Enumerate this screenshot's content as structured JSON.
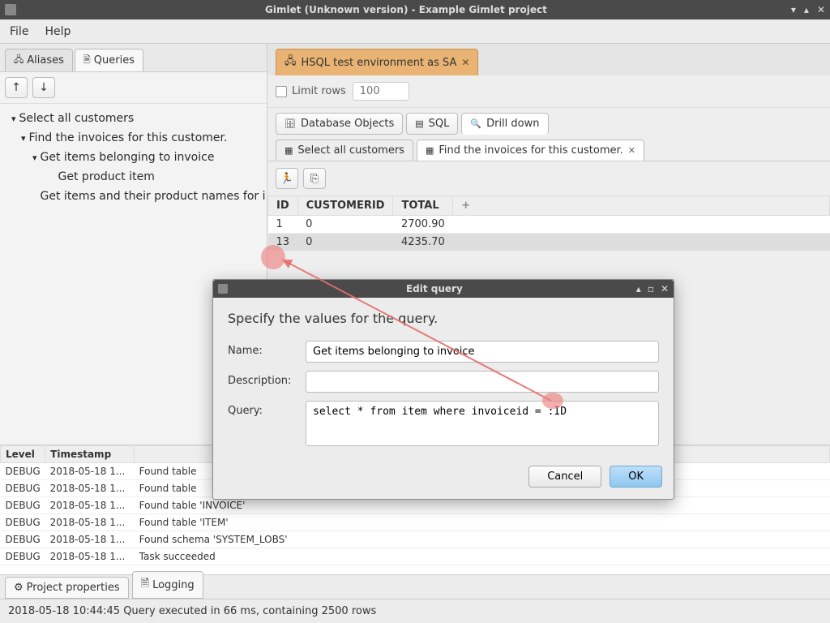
{
  "window": {
    "title": "Gimlet (Unknown version) - Example Gimlet project"
  },
  "menu": {
    "file": "File",
    "help": "Help"
  },
  "left": {
    "tabs": {
      "aliases": "Aliases",
      "queries": "Queries"
    },
    "tree": {
      "root": "Select all customers",
      "child1": "Find the invoices for this customer.",
      "child2": "Get items belonging to invoice",
      "child3": "Get product item",
      "child4": "Get items and their product names for i"
    }
  },
  "right": {
    "conn_tab": "HSQL test environment as SA",
    "limit_label": "Limit rows",
    "limit_value": "100",
    "modes": {
      "dbobjects": "Database Objects",
      "sql": "SQL",
      "drilldown": "Drill down"
    },
    "result_tabs": {
      "t1": "Select all customers",
      "t2": "Find the invoices for this customer."
    },
    "table": {
      "columns": [
        "ID",
        "CUSTOMERID",
        "TOTAL"
      ],
      "rows": [
        {
          "id": "1",
          "customerid": "0",
          "total": "2700.90"
        },
        {
          "id": "13",
          "customerid": "0",
          "total": "4235.70"
        }
      ]
    }
  },
  "log": {
    "headers": {
      "level": "Level",
      "ts": "Timestamp",
      "msg_blank": ""
    },
    "rows": [
      {
        "level": "DEBUG",
        "ts": "2018-05-18 1...",
        "msg": "   Found table"
      },
      {
        "level": "DEBUG",
        "ts": "2018-05-18 1...",
        "msg": "   Found table"
      },
      {
        "level": "DEBUG",
        "ts": "2018-05-18 1...",
        "msg": "   Found table 'INVOICE'"
      },
      {
        "level": "DEBUG",
        "ts": "2018-05-18 1...",
        "msg": "   Found table 'ITEM'"
      },
      {
        "level": "DEBUG",
        "ts": "2018-05-18 1...",
        "msg": "  Found schema 'SYSTEM_LOBS'"
      },
      {
        "level": "DEBUG",
        "ts": "2018-05-18 1...",
        "msg": "Task succeeded"
      }
    ]
  },
  "bottom_tabs": {
    "project": "Project properties",
    "logging": "Logging"
  },
  "status": "2018-05-18 10:44:45 Query executed in 66 ms, containing 2500 rows",
  "dialog": {
    "title": "Edit query",
    "heading": "Specify the values for the query.",
    "labels": {
      "name": "Name:",
      "description": "Description:",
      "query": "Query:"
    },
    "name_value": "Get items belonging to invoice",
    "description_value": "",
    "query_value": "select * from item where invoiceid = :ID",
    "cancel": "Cancel",
    "ok": "OK"
  }
}
